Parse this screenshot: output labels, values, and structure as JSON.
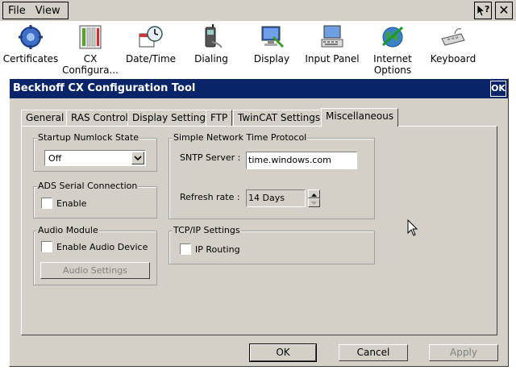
{
  "menubar": {
    "file_label": "File",
    "view_label": "View",
    "help_label": "?",
    "close_label": "✕"
  },
  "control_panel": {
    "items": [
      {
        "label": "Certificates",
        "icon": "certificates-icon"
      },
      {
        "label": "CX Configura...",
        "icon": "cx-config-icon"
      },
      {
        "label": "Date/Time",
        "icon": "datetime-icon"
      },
      {
        "label": "Dialing",
        "icon": "dialing-icon"
      },
      {
        "label": "Display",
        "icon": "display-icon"
      },
      {
        "label": "Input Panel",
        "icon": "input-panel-icon"
      },
      {
        "label": "Internet Options",
        "icon": "internet-options-icon"
      },
      {
        "label": "Keyboard",
        "icon": "keyboard-icon"
      }
    ]
  },
  "dialog": {
    "title": "Beckhoff CX Configuration Tool",
    "title_ok": "OK",
    "tabs": [
      {
        "label": "General"
      },
      {
        "label": "RAS Control"
      },
      {
        "label": "Display Settings"
      },
      {
        "label": "FTP"
      },
      {
        "label": "TwinCAT Settings"
      },
      {
        "label": "Miscellaneous",
        "active": true
      }
    ],
    "startup_numlock": {
      "label": "Startup Numlock State",
      "value": "Off"
    },
    "ads_serial": {
      "label": "ADS Serial Connection",
      "checkbox_label": "Enable",
      "checked": false
    },
    "audio": {
      "label": "Audio Module",
      "checkbox_label": "Enable Audio Device",
      "checked": false,
      "settings_button": "Audio Settings"
    },
    "sntp": {
      "label": "Simple Network Time Protocol",
      "server_label": "SNTP Server :",
      "server_value": "time.windows.com",
      "refresh_label": "Refresh rate :",
      "refresh_value": "14 Days"
    },
    "tcpip": {
      "label": "TCP/IP Settings",
      "checkbox_label": "IP Routing",
      "checked": false
    },
    "buttons": {
      "ok": "OK",
      "cancel": "Cancel",
      "apply": "Apply"
    }
  },
  "colors": {
    "titlebar": "#0a246a",
    "face": "#d4d0c8"
  }
}
